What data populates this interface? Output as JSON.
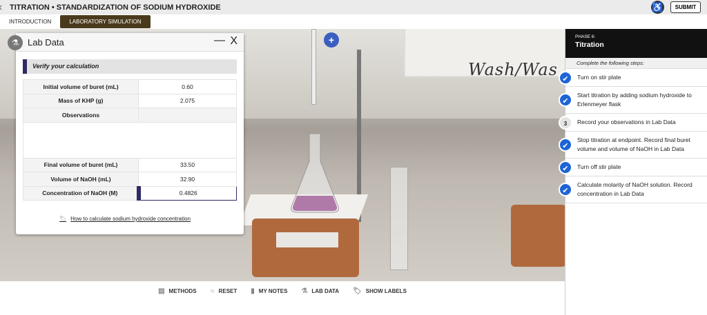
{
  "header": {
    "title": "TITRATION • STANDARDIZATION OF SODIUM HYDROXIDE",
    "submit": "SUBMIT"
  },
  "tabs": [
    {
      "label": "INTRODUCTION"
    },
    {
      "label": "LABORATORY SIMULATION",
      "active": true
    }
  ],
  "scene": {
    "sink_label": "Wash/Was"
  },
  "lab_data": {
    "title": "Lab Data",
    "minimize": "—",
    "close": "X",
    "section": "Verify your calculation",
    "rows": [
      {
        "label": "Initial volume of buret (mL)",
        "value": "0.60"
      },
      {
        "label": "Mass of KHP (g)",
        "value": "2.075"
      },
      {
        "label": "Observations",
        "value": ""
      },
      {
        "label": "Final volume of buret (mL)",
        "value": "33.50"
      },
      {
        "label": "Volume of NaOH (mL)",
        "value": "32.90"
      },
      {
        "label": "Concentration of NaOH (M)",
        "value": "0.4826"
      }
    ],
    "link": "How to calculate sodium hydroxide concentration"
  },
  "toolbar": [
    {
      "label": "METHODS",
      "icon": "methods-icon"
    },
    {
      "label": "RESET",
      "icon": "reset-icon"
    },
    {
      "label": "MY NOTES",
      "icon": "notes-icon"
    },
    {
      "label": "LAB DATA",
      "icon": "flask-icon"
    },
    {
      "label": "SHOW LABELS",
      "icon": "tag-icon"
    }
  ],
  "phase": {
    "phase": "PHASE 6:",
    "title": "Titration",
    "instructions": "Complete the following steps:",
    "steps": [
      {
        "text": "Turn on stir plate",
        "status": "done"
      },
      {
        "text": "Start titration by adding sodium hydroxide to Erlenmeyer flask",
        "status": "done"
      },
      {
        "text": "Record your observations in Lab Data",
        "status": "3"
      },
      {
        "text": "Stop titration at endpoint. Record final buret volume and volume of NaOH in Lab Data",
        "status": "done"
      },
      {
        "text": "Turn off stir plate",
        "status": "done"
      },
      {
        "text": "Calculate molarity of NaOH solution. Record concentration in Lab Data",
        "status": "done"
      }
    ]
  },
  "colors": {
    "accent": "#2e2a62",
    "tab_active": "#4a3a1c",
    "check": "#1e64d6"
  }
}
